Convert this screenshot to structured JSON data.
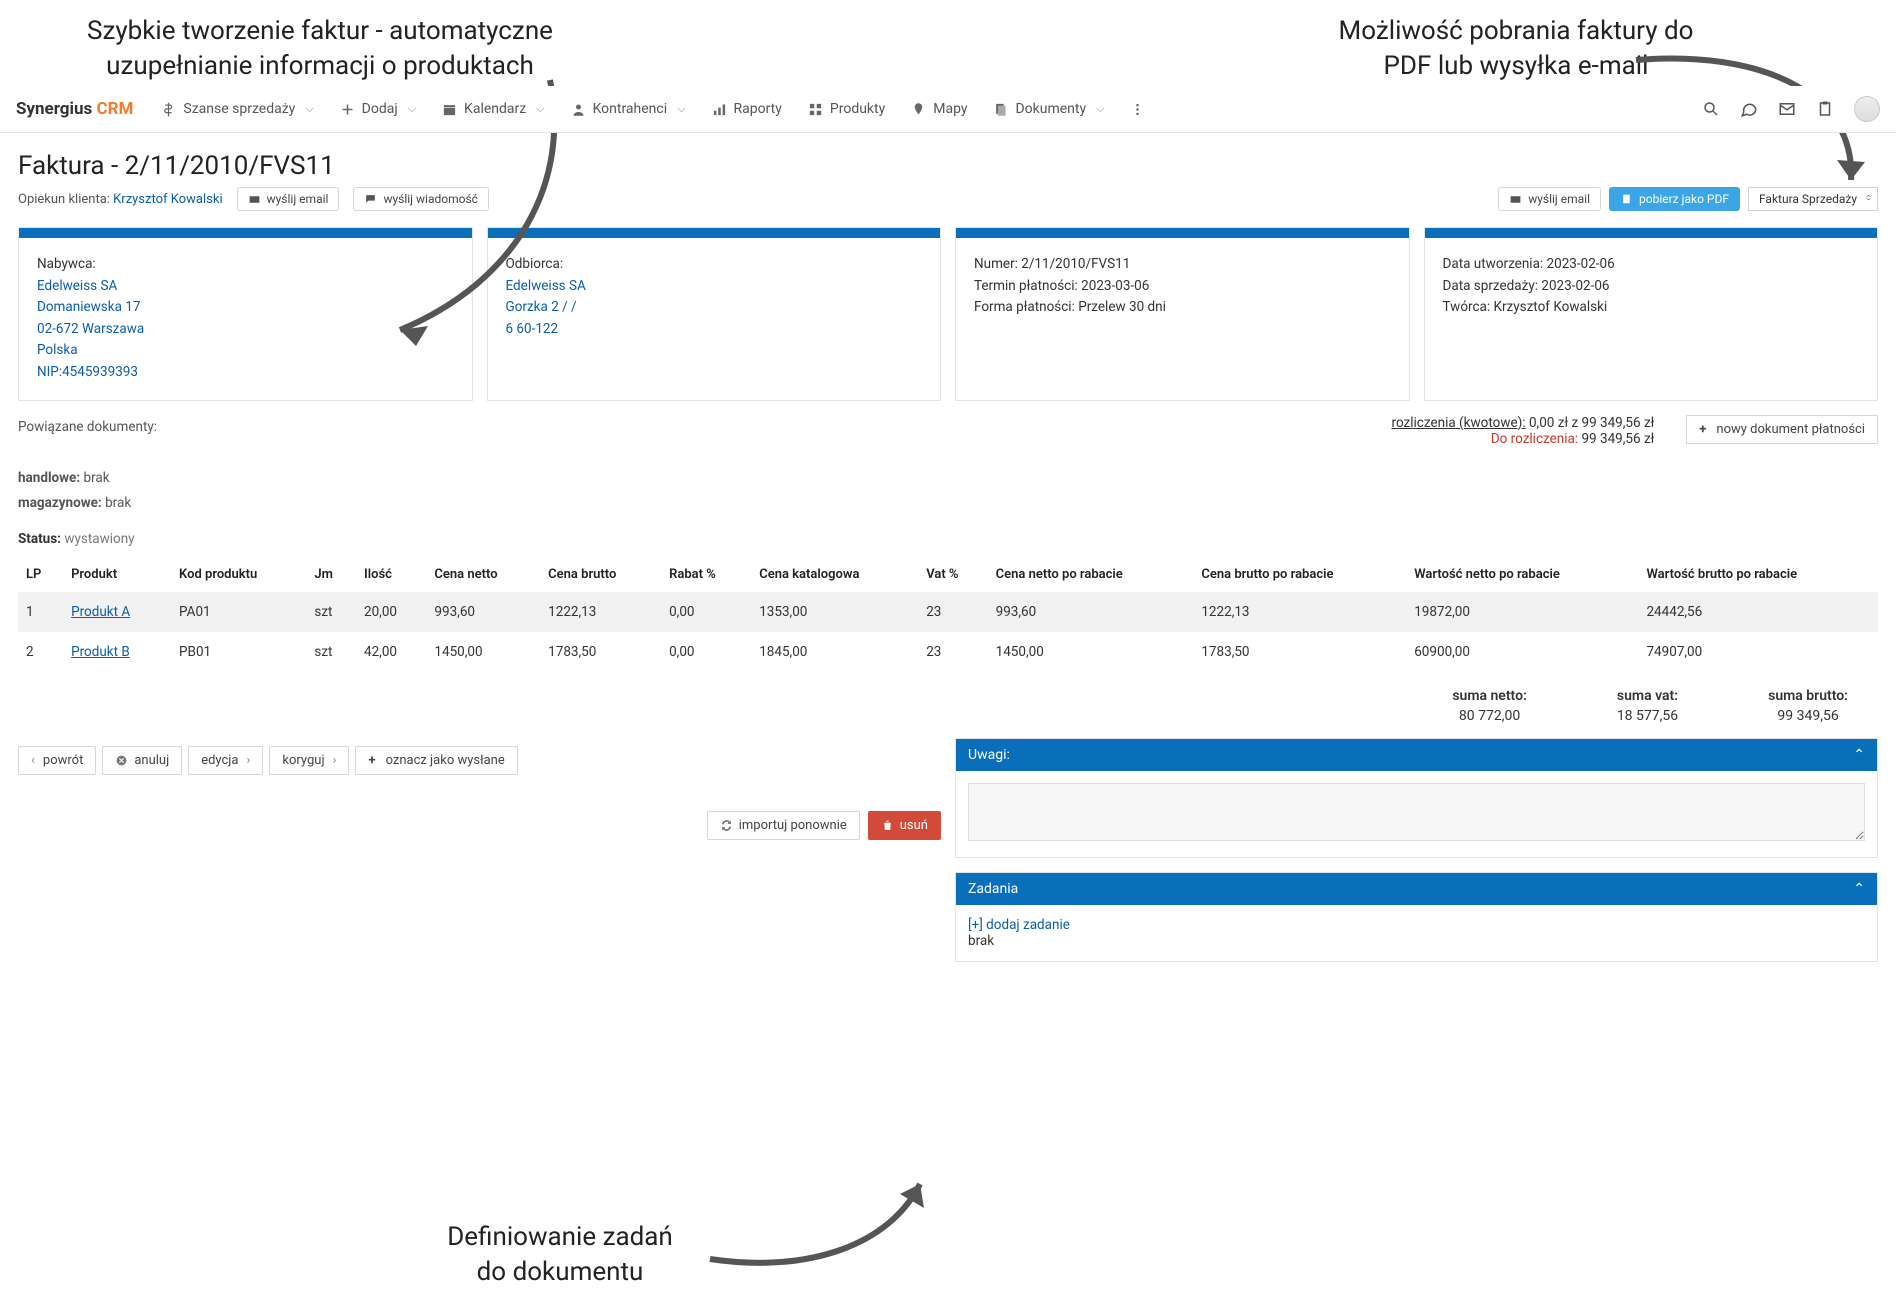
{
  "callouts": {
    "top_left": "Szybkie tworzenie faktur - automatyczne uzupełnianie informacji o produktach",
    "top_right": "Możliwość pobrania faktury do PDF lub wysyłka e-mail",
    "bottom": "Definiowanie zadań do dokumentu"
  },
  "logo": {
    "a": "Synergius ",
    "b": "CRM"
  },
  "nav": {
    "sales": "Szanse sprzedaży",
    "add": "Dodaj",
    "calendar": "Kalendarz",
    "contractors": "Kontrahenci",
    "reports": "Raporty",
    "products": "Produkty",
    "maps": "Mapy",
    "documents": "Dokumenty"
  },
  "page_title": "Faktura - 2/11/2010/FVS11",
  "owner_label": "Opiekun klienta: ",
  "owner_name": "Krzysztof Kowalski",
  "btn_send_email": "wyślij email",
  "btn_send_msg": "wyślij wiadomość",
  "btn_send_email_2": "wyślij email",
  "btn_download_pdf": "pobierz jako PDF",
  "invoice_type": "Faktura Sprzedaży",
  "cards": {
    "buyer": {
      "label": "Nabywca:",
      "name": "Edelweiss SA",
      "street": "Domaniewska 17",
      "city": "02-672 Warszawa",
      "country": "Polska",
      "nip": "NIP:4545939393"
    },
    "recipient": {
      "label": "Odbiorca:",
      "name": "Edelweiss SA",
      "street": "Gorzka 2 / /",
      "code": "6 60-122"
    },
    "details": {
      "num_label": "Numer: ",
      "num": "2/11/2010/FVS11",
      "due_label": "Termin płatności: ",
      "due": "2023-03-06",
      "pay_label": "Forma płatności: ",
      "pay": "Przelew 30 dni"
    },
    "meta": {
      "created_label": "Data utworzenia: ",
      "created": "2023-02-06",
      "sale_label": "Data sprzedaży: ",
      "sale": "2023-02-06",
      "author_label": "Twórca: ",
      "author": "Krzysztof Kowalski"
    }
  },
  "related": {
    "label": "Powiązane dokumenty:",
    "commercial_label": "handlowe: ",
    "commercial": "brak",
    "warehouse_label": "magazynowe: ",
    "warehouse": "brak"
  },
  "settlements": {
    "line1a": "rozliczenia (kwotowe):",
    "line1b": " 0,00 zł z 99 349,56 zł",
    "line2a": "Do rozliczenia:",
    "line2b": " 99 349,56 zł",
    "new_btn": "nowy dokument płatności"
  },
  "status_label": "Status: ",
  "status_value": "wystawiony",
  "table": {
    "headers": {
      "lp": "LP",
      "product": "Produkt",
      "code": "Kod produktu",
      "unit": "Jm",
      "qty": "Ilość",
      "net": "Cena netto",
      "gross": "Cena brutto",
      "discount": "Rabat %",
      "catalog": "Cena katalogowa",
      "vat": "Vat %",
      "net_after": "Cena netto po rabacie",
      "gross_after": "Cena brutto po rabacie",
      "val_net": "Wartość netto po rabacie",
      "val_gross": "Wartość brutto po rabacie"
    },
    "rows": [
      {
        "lp": "1",
        "product": "Produkt A",
        "code": "PA01",
        "unit": "szt",
        "qty": "20,00",
        "net": "993,60",
        "gross": "1222,13",
        "discount": "0,00",
        "catalog": "1353,00",
        "vat": "23",
        "net_after": "993,60",
        "gross_after": "1222,13",
        "val_net": "19872,00",
        "val_gross": "24442,56"
      },
      {
        "lp": "2",
        "product": "Produkt B",
        "code": "PB01",
        "unit": "szt",
        "qty": "42,00",
        "net": "1450,00",
        "gross": "1783,50",
        "discount": "0,00",
        "catalog": "1845,00",
        "vat": "23",
        "net_after": "1450,00",
        "gross_after": "1783,50",
        "val_net": "60900,00",
        "val_gross": "74907,00"
      }
    ]
  },
  "sums": {
    "net_label": "suma netto:",
    "net": "80 772,00",
    "vat_label": "suma vat:",
    "vat": "18 577,56",
    "gross_label": "suma brutto:",
    "gross": "99 349,56"
  },
  "buttons": {
    "back": "powrót",
    "cancel": "anuluj",
    "edit": "edycja",
    "correct": "koryguj",
    "mark_sent": "oznacz jako wysłane",
    "reimport": "importuj ponownie",
    "delete": "usuń"
  },
  "panels": {
    "notes_title": "Uwagi:",
    "tasks_title": "Zadania",
    "add_task": "[+] dodaj zadanie",
    "none": "brak"
  }
}
